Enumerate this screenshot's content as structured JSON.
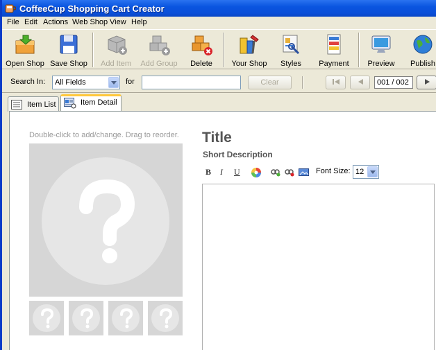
{
  "window": {
    "title": "CoffeeCup Shopping Cart Creator"
  },
  "menu": [
    "File",
    "Edit",
    "Actions",
    "Web Shop",
    "View",
    "Help"
  ],
  "toolbar": {
    "open_shop": "Open Shop",
    "save_shop": "Save Shop",
    "add_item": "Add Item",
    "add_group": "Add Group",
    "delete": "Delete",
    "your_shop": "Your Shop",
    "styles": "Styles",
    "payment": "Payment",
    "preview": "Preview",
    "publish": "Publish"
  },
  "search": {
    "search_in_label": "Search In:",
    "field_value": "All Fields",
    "for_label": "for",
    "query": "",
    "clear_label": "Clear",
    "page": "001 / 002"
  },
  "tabs": {
    "item_list": "Item List",
    "item_detail": "Item Detail"
  },
  "detail": {
    "hint": "Double-click to add/change. Drag to reorder.",
    "title": "Title",
    "short_description": "Short Description",
    "format": {
      "bold": "B",
      "italic": "I",
      "underline": "U",
      "font_size_label": "Font Size:",
      "font_size": "12"
    },
    "description": ""
  },
  "colors": {
    "titlebar": "#0a55e0",
    "chrome": "#ece9d8",
    "placeholder": "#d6d6d6",
    "active_tab_accent": "#ffc83c"
  }
}
